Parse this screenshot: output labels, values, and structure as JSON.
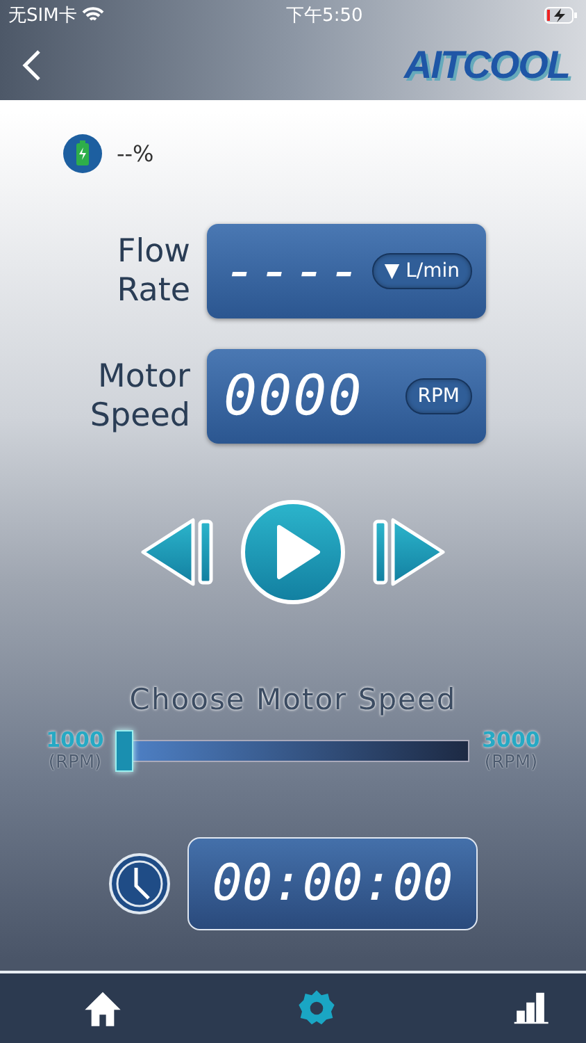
{
  "status_bar": {
    "carrier": "无SIM卡",
    "time": "下午5:50"
  },
  "nav": {
    "logo": "AITCOOL"
  },
  "battery": {
    "reading": "--%"
  },
  "readouts": [
    {
      "label": "Flow Rate",
      "value": "----",
      "unit": "▼ L/min"
    },
    {
      "label": "Motor Speed",
      "value": "0000",
      "unit": "RPM"
    }
  ],
  "speed": {
    "title": "Choose Motor Speed",
    "min": "1000",
    "min_unit": "(RPM)",
    "max": "3000",
    "max_unit": "(RPM)",
    "level": 0
  },
  "timer": {
    "value": "00:00:00"
  },
  "tabs": [
    {
      "kind": "home",
      "selected": false
    },
    {
      "kind": "settings",
      "selected": true
    },
    {
      "kind": "chart",
      "selected": false
    }
  ]
}
